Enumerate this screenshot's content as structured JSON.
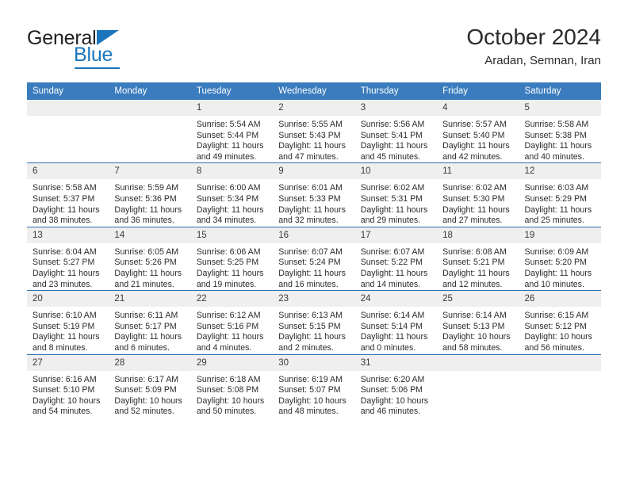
{
  "brand": {
    "name_top": "General",
    "name_bottom": "Blue",
    "accent_color": "#1b75bb"
  },
  "header": {
    "title": "October 2024",
    "subtitle": "Aradan, Semnan, Iran"
  },
  "theme": {
    "header_row_bg": "#3a7cbe",
    "daynum_bg": "#efefef",
    "row_divider": "#2f6fae"
  },
  "weekday_headers": [
    "Sunday",
    "Monday",
    "Tuesday",
    "Wednesday",
    "Thursday",
    "Friday",
    "Saturday"
  ],
  "weeks": [
    [
      {
        "day": "",
        "sunrise": "",
        "sunset": "",
        "daylight": ""
      },
      {
        "day": "",
        "sunrise": "",
        "sunset": "",
        "daylight": ""
      },
      {
        "day": "1",
        "sunrise": "Sunrise: 5:54 AM",
        "sunset": "Sunset: 5:44 PM",
        "daylight": "Daylight: 11 hours and 49 minutes."
      },
      {
        "day": "2",
        "sunrise": "Sunrise: 5:55 AM",
        "sunset": "Sunset: 5:43 PM",
        "daylight": "Daylight: 11 hours and 47 minutes."
      },
      {
        "day": "3",
        "sunrise": "Sunrise: 5:56 AM",
        "sunset": "Sunset: 5:41 PM",
        "daylight": "Daylight: 11 hours and 45 minutes."
      },
      {
        "day": "4",
        "sunrise": "Sunrise: 5:57 AM",
        "sunset": "Sunset: 5:40 PM",
        "daylight": "Daylight: 11 hours and 42 minutes."
      },
      {
        "day": "5",
        "sunrise": "Sunrise: 5:58 AM",
        "sunset": "Sunset: 5:38 PM",
        "daylight": "Daylight: 11 hours and 40 minutes."
      }
    ],
    [
      {
        "day": "6",
        "sunrise": "Sunrise: 5:58 AM",
        "sunset": "Sunset: 5:37 PM",
        "daylight": "Daylight: 11 hours and 38 minutes."
      },
      {
        "day": "7",
        "sunrise": "Sunrise: 5:59 AM",
        "sunset": "Sunset: 5:36 PM",
        "daylight": "Daylight: 11 hours and 36 minutes."
      },
      {
        "day": "8",
        "sunrise": "Sunrise: 6:00 AM",
        "sunset": "Sunset: 5:34 PM",
        "daylight": "Daylight: 11 hours and 34 minutes."
      },
      {
        "day": "9",
        "sunrise": "Sunrise: 6:01 AM",
        "sunset": "Sunset: 5:33 PM",
        "daylight": "Daylight: 11 hours and 32 minutes."
      },
      {
        "day": "10",
        "sunrise": "Sunrise: 6:02 AM",
        "sunset": "Sunset: 5:31 PM",
        "daylight": "Daylight: 11 hours and 29 minutes."
      },
      {
        "day": "11",
        "sunrise": "Sunrise: 6:02 AM",
        "sunset": "Sunset: 5:30 PM",
        "daylight": "Daylight: 11 hours and 27 minutes."
      },
      {
        "day": "12",
        "sunrise": "Sunrise: 6:03 AM",
        "sunset": "Sunset: 5:29 PM",
        "daylight": "Daylight: 11 hours and 25 minutes."
      }
    ],
    [
      {
        "day": "13",
        "sunrise": "Sunrise: 6:04 AM",
        "sunset": "Sunset: 5:27 PM",
        "daylight": "Daylight: 11 hours and 23 minutes."
      },
      {
        "day": "14",
        "sunrise": "Sunrise: 6:05 AM",
        "sunset": "Sunset: 5:26 PM",
        "daylight": "Daylight: 11 hours and 21 minutes."
      },
      {
        "day": "15",
        "sunrise": "Sunrise: 6:06 AM",
        "sunset": "Sunset: 5:25 PM",
        "daylight": "Daylight: 11 hours and 19 minutes."
      },
      {
        "day": "16",
        "sunrise": "Sunrise: 6:07 AM",
        "sunset": "Sunset: 5:24 PM",
        "daylight": "Daylight: 11 hours and 16 minutes."
      },
      {
        "day": "17",
        "sunrise": "Sunrise: 6:07 AM",
        "sunset": "Sunset: 5:22 PM",
        "daylight": "Daylight: 11 hours and 14 minutes."
      },
      {
        "day": "18",
        "sunrise": "Sunrise: 6:08 AM",
        "sunset": "Sunset: 5:21 PM",
        "daylight": "Daylight: 11 hours and 12 minutes."
      },
      {
        "day": "19",
        "sunrise": "Sunrise: 6:09 AM",
        "sunset": "Sunset: 5:20 PM",
        "daylight": "Daylight: 11 hours and 10 minutes."
      }
    ],
    [
      {
        "day": "20",
        "sunrise": "Sunrise: 6:10 AM",
        "sunset": "Sunset: 5:19 PM",
        "daylight": "Daylight: 11 hours and 8 minutes."
      },
      {
        "day": "21",
        "sunrise": "Sunrise: 6:11 AM",
        "sunset": "Sunset: 5:17 PM",
        "daylight": "Daylight: 11 hours and 6 minutes."
      },
      {
        "day": "22",
        "sunrise": "Sunrise: 6:12 AM",
        "sunset": "Sunset: 5:16 PM",
        "daylight": "Daylight: 11 hours and 4 minutes."
      },
      {
        "day": "23",
        "sunrise": "Sunrise: 6:13 AM",
        "sunset": "Sunset: 5:15 PM",
        "daylight": "Daylight: 11 hours and 2 minutes."
      },
      {
        "day": "24",
        "sunrise": "Sunrise: 6:14 AM",
        "sunset": "Sunset: 5:14 PM",
        "daylight": "Daylight: 11 hours and 0 minutes."
      },
      {
        "day": "25",
        "sunrise": "Sunrise: 6:14 AM",
        "sunset": "Sunset: 5:13 PM",
        "daylight": "Daylight: 10 hours and 58 minutes."
      },
      {
        "day": "26",
        "sunrise": "Sunrise: 6:15 AM",
        "sunset": "Sunset: 5:12 PM",
        "daylight": "Daylight: 10 hours and 56 minutes."
      }
    ],
    [
      {
        "day": "27",
        "sunrise": "Sunrise: 6:16 AM",
        "sunset": "Sunset: 5:10 PM",
        "daylight": "Daylight: 10 hours and 54 minutes."
      },
      {
        "day": "28",
        "sunrise": "Sunrise: 6:17 AM",
        "sunset": "Sunset: 5:09 PM",
        "daylight": "Daylight: 10 hours and 52 minutes."
      },
      {
        "day": "29",
        "sunrise": "Sunrise: 6:18 AM",
        "sunset": "Sunset: 5:08 PM",
        "daylight": "Daylight: 10 hours and 50 minutes."
      },
      {
        "day": "30",
        "sunrise": "Sunrise: 6:19 AM",
        "sunset": "Sunset: 5:07 PM",
        "daylight": "Daylight: 10 hours and 48 minutes."
      },
      {
        "day": "31",
        "sunrise": "Sunrise: 6:20 AM",
        "sunset": "Sunset: 5:06 PM",
        "daylight": "Daylight: 10 hours and 46 minutes."
      },
      {
        "day": "",
        "sunrise": "",
        "sunset": "",
        "daylight": ""
      },
      {
        "day": "",
        "sunrise": "",
        "sunset": "",
        "daylight": ""
      }
    ]
  ]
}
